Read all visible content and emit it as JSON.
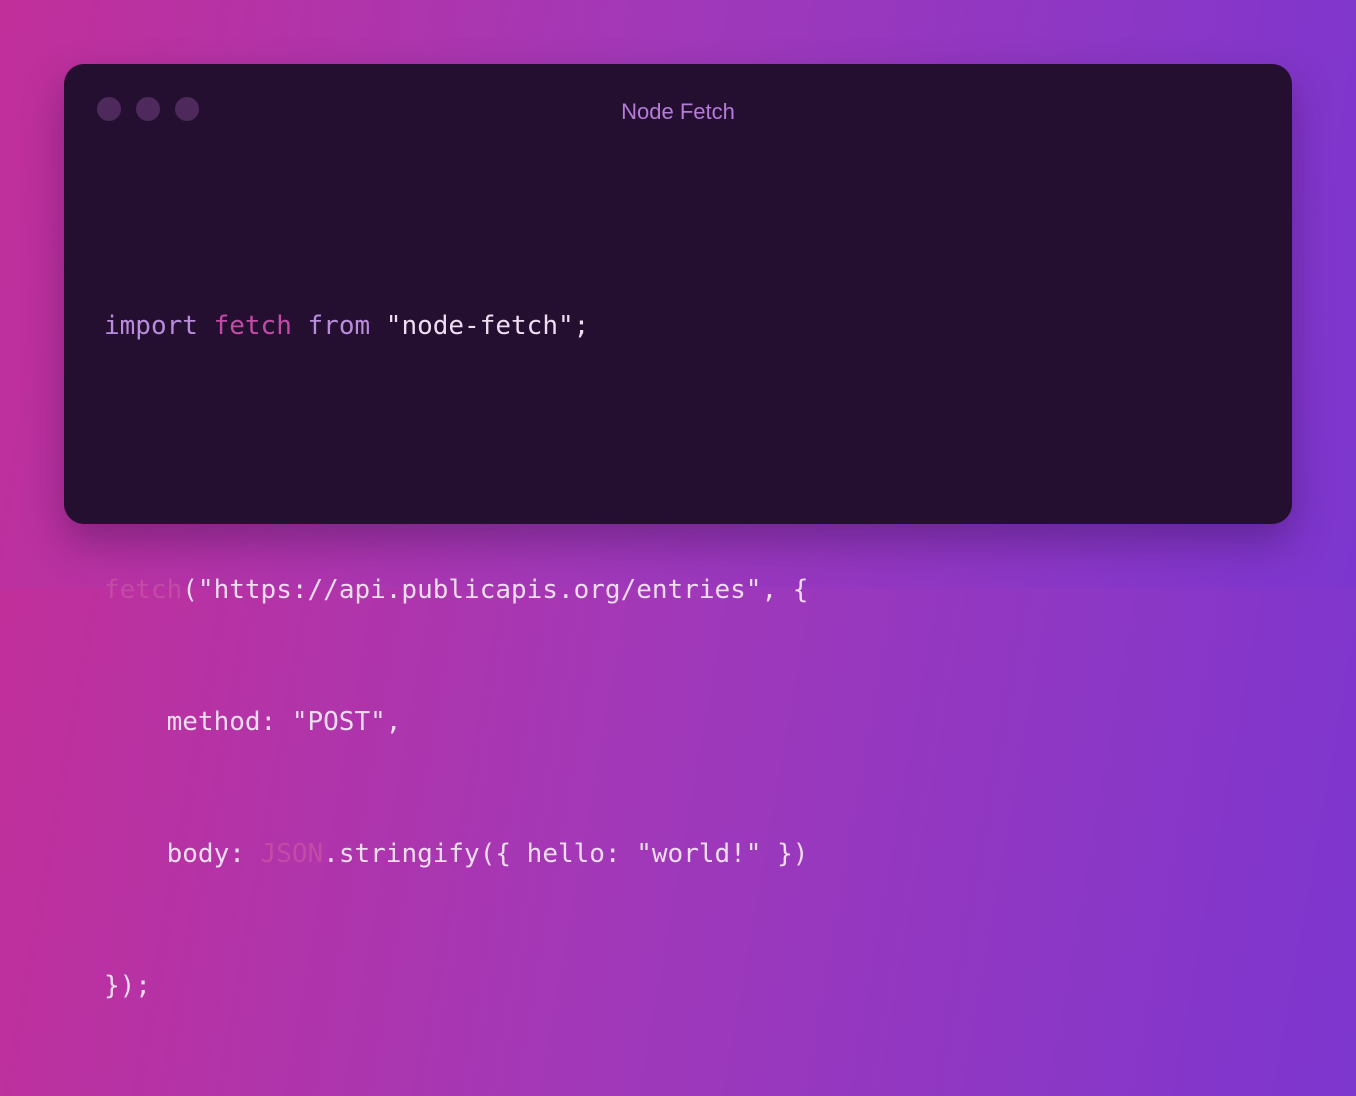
{
  "window": {
    "title": "Node Fetch",
    "controls": [
      "close-icon",
      "minimize-icon",
      "maximize-icon"
    ]
  },
  "code": {
    "line1": {
      "t1": "import",
      "t2": " ",
      "t3": "fetch",
      "t4": " ",
      "t5": "from",
      "t6": " \"node-fetch\";"
    },
    "line3": {
      "t1": "fetch",
      "t2": "(\"https://api.publicapis.org/entries\", {"
    },
    "line4": {
      "t1": "    method: \"POST\","
    },
    "line5": {
      "t1": "    body: ",
      "t2": "JSON",
      "t3": ".stringify({ hello: \"world!\" })"
    },
    "line6": {
      "t1": "});"
    }
  },
  "colors": {
    "background_start": "#c12f9a",
    "background_end": "#7c36cf",
    "window_bg": "#240f31",
    "keyword": "#b98bdb",
    "function": "#c24ba6",
    "text": "#eedcf0"
  }
}
